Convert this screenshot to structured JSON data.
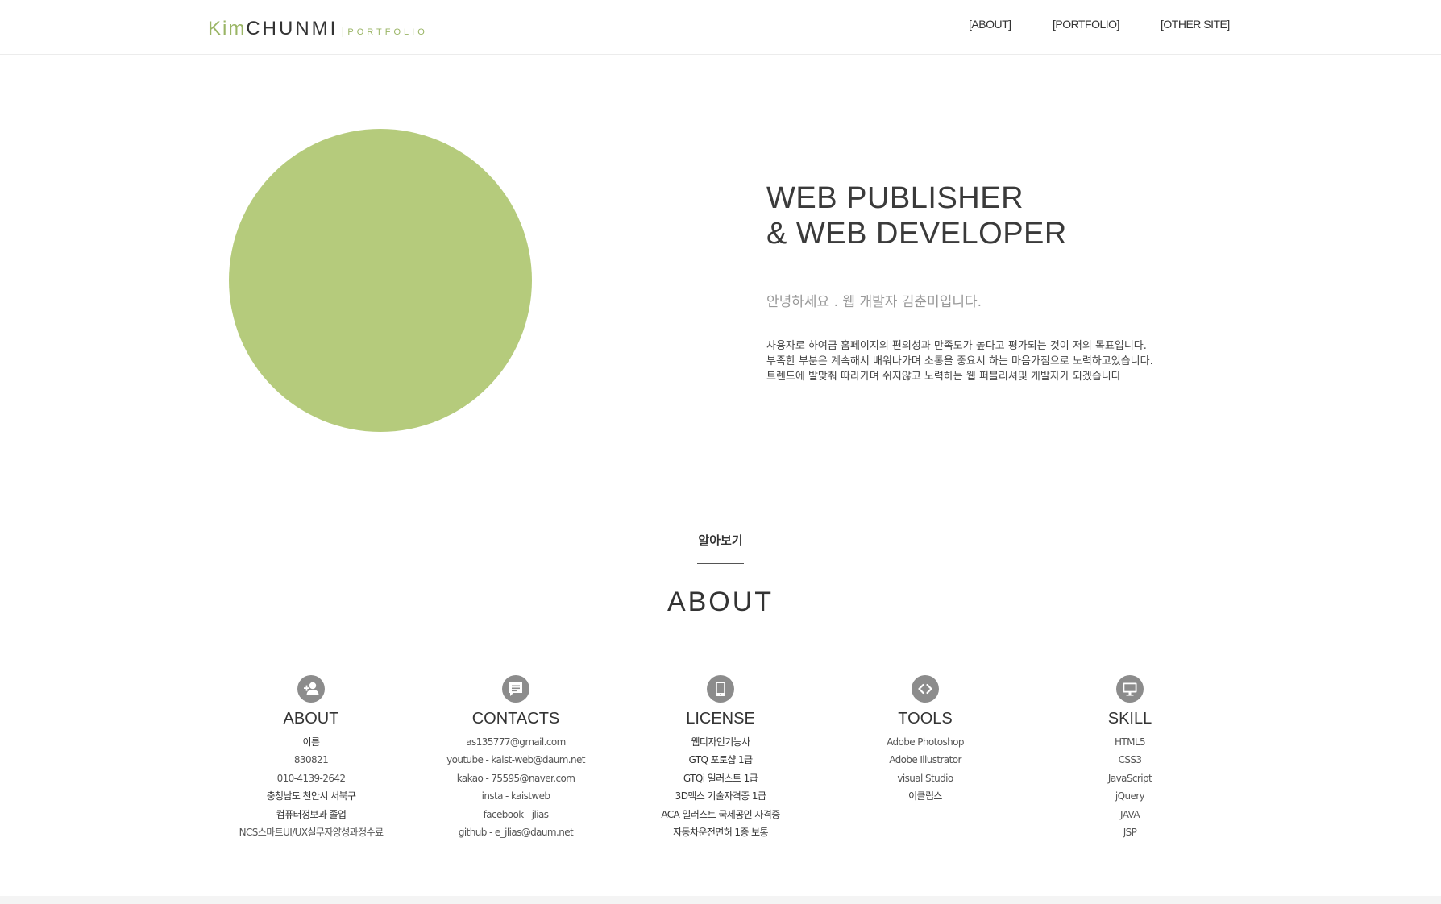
{
  "header": {
    "logo": {
      "kim": "Kim",
      "name": "CHUNMI",
      "separator": "|",
      "portfolio": "PORTFOLIO"
    },
    "nav": [
      "[ABOUT]",
      "[PORTFOLIO]",
      "[OTHER SITE]"
    ]
  },
  "hero": {
    "title_line1": "WEB PUBLISHER",
    "title_line2": "& WEB DEVELOPER",
    "greeting": "안녕하세요 . 웹 개발자 김춘미입니다.",
    "desc": [
      "사용자로 하여금 홈페이지의 편의성과 만족도가 높다고 평가되는 것이 저의 목표입니다.",
      "부족한 부분은 계속해서 배워나가며 소통을 중요시 하는 마음가짐으로 노력하고있습니다.",
      "트렌드에 발맞춰 따라가며 쉬지않고 노력하는 웹 퍼블리셔및 개발자가 되겠습니다"
    ],
    "circle_color": "#b5cb7c"
  },
  "section": {
    "subtitle": "알아보기",
    "title": "ABOUT"
  },
  "columns": [
    {
      "icon": "add-user-icon",
      "title": "ABOUT",
      "items": [
        "이름",
        "830821",
        "010-4139-2642",
        "충청남도 천안시 서북구",
        "컴퓨터정보과 졸업",
        "NCS스마트UI/UX실무자양성과정수료"
      ]
    },
    {
      "icon": "chat-icon",
      "title": "CONTACTS",
      "items": [
        "as135777@gmail.com",
        "youtube - kaist-web@daum.net",
        "kakao - 75595@naver.com",
        "insta - kaistweb",
        "facebook - jlias",
        "github - e_jlias@daum.net"
      ]
    },
    {
      "icon": "tablet-icon",
      "title": "LICENSE",
      "items": [
        "웹디자인기능사",
        "GTQ 포토샵 1급",
        "GTQi 일러스트 1급",
        "3D맥스 기술자격증 1급",
        "ACA 일러스트 국제공인 자격증",
        "자동차운전면허 1종 보통"
      ]
    },
    {
      "icon": "code-icon",
      "title": "TOOLS",
      "items": [
        "Adobe Photoshop",
        "Adobe Illustrator",
        "visual Studio",
        "이클립스"
      ]
    },
    {
      "icon": "monitor-icon",
      "title": "SKILL",
      "items": [
        "HTML5",
        "CSS3",
        "JavaScript",
        "jQuery",
        "JAVA",
        "JSP"
      ]
    }
  ]
}
